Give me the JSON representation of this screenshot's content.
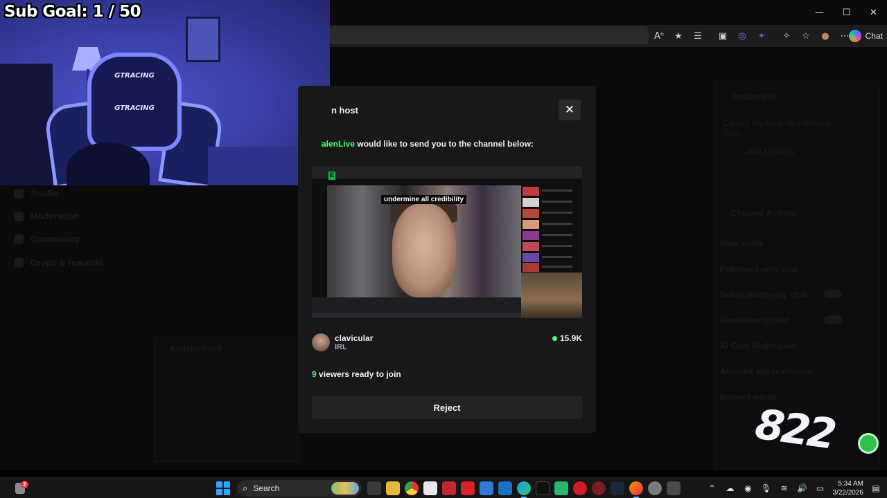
{
  "overlay": {
    "sub_goal": "Sub Goal:  1 / 50",
    "chair_brand": "GTRACING",
    "sticker_number": "822"
  },
  "browser": {
    "window_controls": {
      "minimize": "—",
      "maximize": "☐",
      "close": "✕"
    },
    "toolbar_icons": [
      "read-aloud-icon",
      "favorite-star-icon",
      "collections-icon",
      "reading-view-icon",
      "extension-icon",
      "extension-icon",
      "extensions-puzzle-icon",
      "favorites-icon",
      "profile-icon",
      "more-icon"
    ],
    "copilot_label": "Chat"
  },
  "dashboard": {
    "sidebar": [
      {
        "label": "Studio"
      },
      {
        "label": "Moderation"
      },
      {
        "label": "Community"
      },
      {
        "label": "Drops & rewards"
      }
    ],
    "stream_info_title": "Stream Info",
    "stream_title": "Caught My Ex in 4k Followed /Sub",
    "stream_category": "Just Chatting",
    "channel_actions_title": "Channel Actions",
    "actions": [
      "Slow mode",
      "Followers-only chat",
      "Subscribers-only chat",
      "Emotes-only chat",
      "AI Chat Moderation",
      "Account age restriction",
      "Banned words"
    ],
    "activity_feed_title": "Activity Feed"
  },
  "modal": {
    "title": "n host",
    "host_name": "alenLive",
    "send_message": " would like to send you to the channel below:",
    "preview_caption": "undermine all credibility",
    "channel": {
      "name": "clavicular",
      "category": "IRL",
      "viewers": "15.9K"
    },
    "ready_count": "9",
    "ready_text": " viewers ready to join",
    "reject_label": "Reject",
    "close_icon": "✕"
  },
  "taskbar": {
    "notification_count": "2",
    "search_label": "Search",
    "apps": [
      "task-view",
      "file-explorer",
      "chrome",
      "store",
      "shield-app",
      "red-app",
      "edit-app",
      "outlook",
      "edge",
      "tiktok",
      "chat-app",
      "opera",
      "opera-gx",
      "steam",
      "firefox",
      "settings",
      "calculator"
    ],
    "time": "5:34 AM",
    "date": "3/22/2026"
  },
  "colors": {
    "twitch_green": "#4cff6c",
    "modal_bg": "#18181b",
    "button_bg": "#222225"
  }
}
